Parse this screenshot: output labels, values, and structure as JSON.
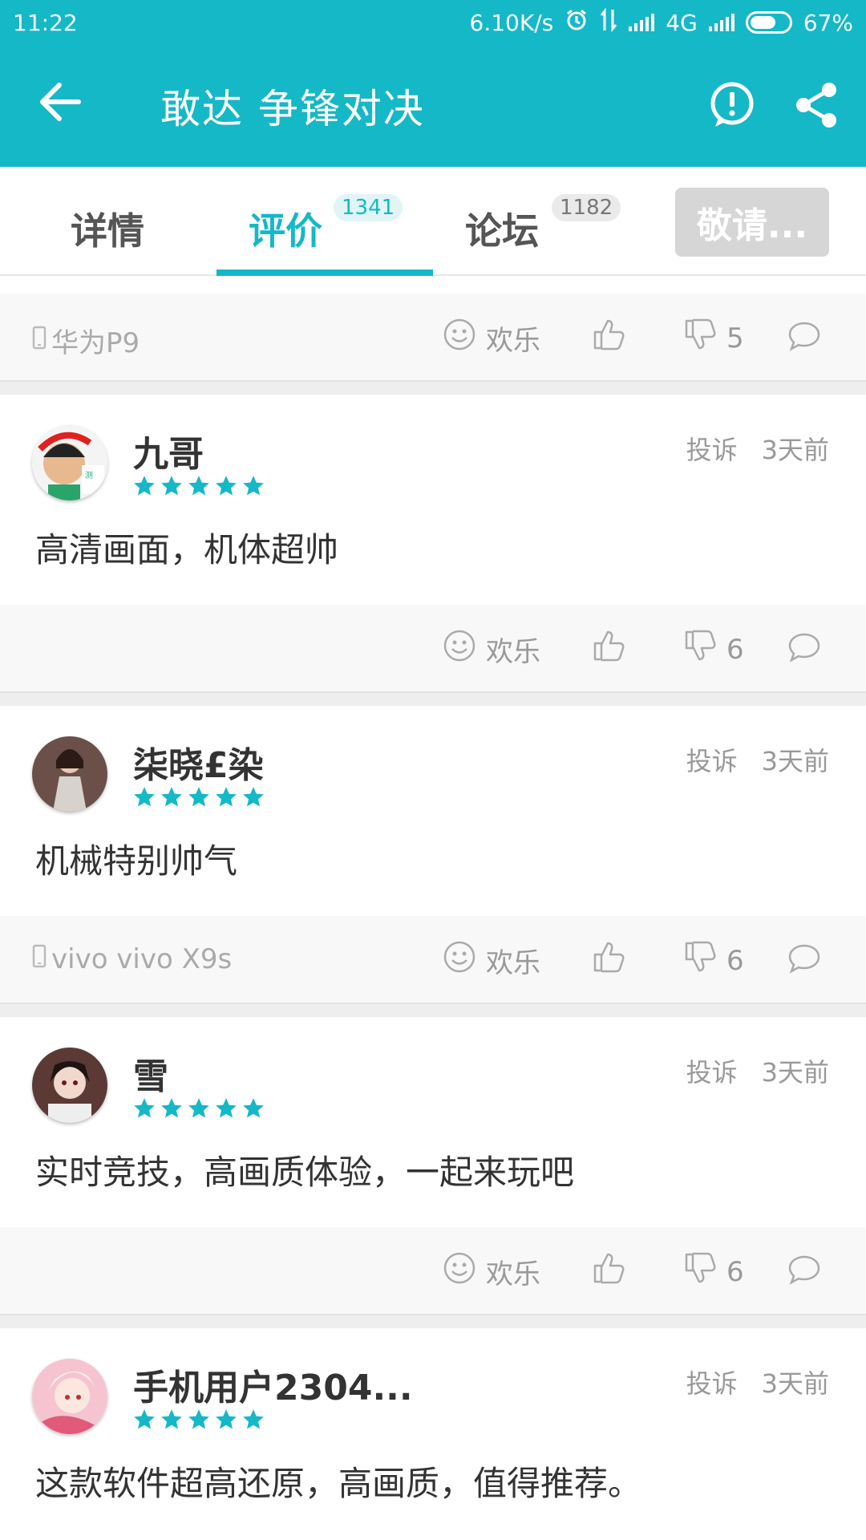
{
  "status_bar": {
    "time": "11:22",
    "speed": "6.10K/s",
    "network": "4G",
    "battery": "67%"
  },
  "app_bar": {
    "title": "敢达 争锋对决"
  },
  "tabs": [
    {
      "label": "详情"
    },
    {
      "label": "评价",
      "count": "1341"
    },
    {
      "label": "论坛",
      "count": "1182"
    }
  ],
  "tab_button": "敬请...",
  "top_action": {
    "device": "华为P9",
    "mood": "欢乐",
    "dislikes": "5"
  },
  "reviews": [
    {
      "name": "九哥",
      "rating": 5,
      "report": "投诉",
      "time": "3天前",
      "text": "高清画面，机体超帅",
      "device": "",
      "mood": "欢乐",
      "dislikes": "6"
    },
    {
      "name": "柒晓£染",
      "rating": 5,
      "report": "投诉",
      "time": "3天前",
      "text": "机械特别帅气",
      "device": "vivo vivo X9s",
      "mood": "欢乐",
      "dislikes": "6"
    },
    {
      "name": "雪",
      "rating": 5,
      "report": "投诉",
      "time": "3天前",
      "text": "实时竞技，高画质体验，一起来玩吧",
      "device": "",
      "mood": "欢乐",
      "dislikes": "6"
    },
    {
      "name": "手机用户2304...",
      "rating": 5,
      "report": "投诉",
      "time": "3天前",
      "text": "这款软件超高还原，高画质，值得推荐。"
    }
  ],
  "colors": {
    "accent": "#15b8c6",
    "star": "#15b8c6",
    "tab_button_bg": "#d6d6d6"
  }
}
